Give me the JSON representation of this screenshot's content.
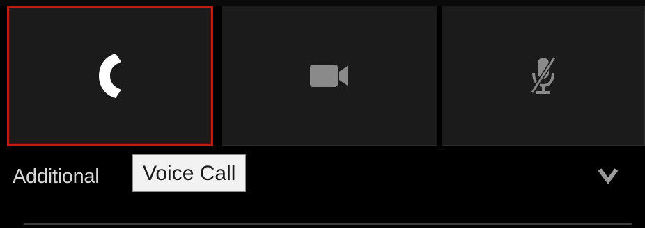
{
  "call_controls": {
    "voice": {
      "icon": "phone-icon",
      "selected": true
    },
    "video": {
      "icon": "video-camera-icon"
    },
    "mute": {
      "icon": "microphone-muted-icon"
    }
  },
  "options": {
    "label": "Additional",
    "chevron_icon": "chevron-down-icon"
  },
  "tooltip": {
    "text": "Voice Call"
  },
  "colors": {
    "selection_border": "#c01b1b",
    "button_bg": "#1b1b1b",
    "icon_active": "#ffffff",
    "icon_inactive": "#8a8a8a"
  }
}
